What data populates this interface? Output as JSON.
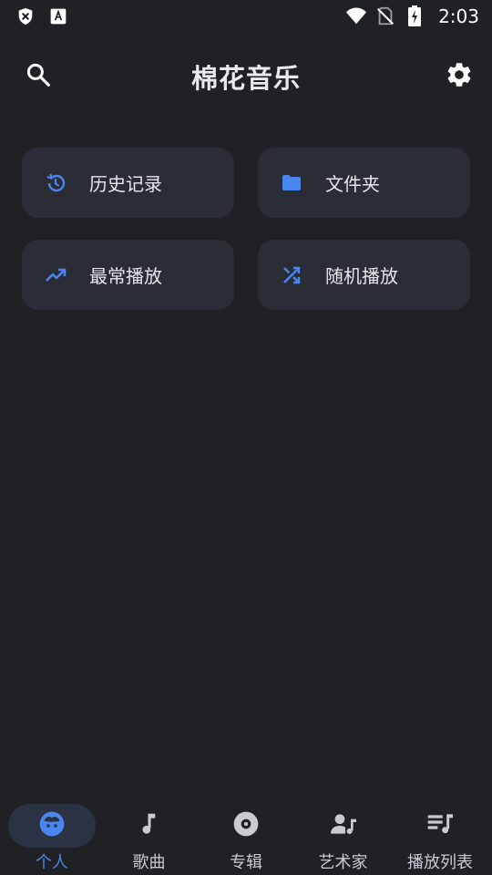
{
  "status_bar": {
    "time": "2:03",
    "left_icons": [
      "shield-x-icon",
      "text-a-icon"
    ],
    "right_icons": [
      "wifi-icon",
      "no-sim-icon",
      "battery-charging-icon"
    ]
  },
  "app_bar": {
    "title": "棉花音乐",
    "left_icon": "search-icon",
    "right_icon": "gear-icon"
  },
  "tiles": [
    {
      "label": "历史记录",
      "icon": "history-icon"
    },
    {
      "label": "文件夹",
      "icon": "folder-icon"
    },
    {
      "label": "最常播放",
      "icon": "trending-up-icon"
    },
    {
      "label": "随机播放",
      "icon": "shuffle-icon"
    }
  ],
  "bottom_nav": {
    "items": [
      {
        "label": "个人",
        "icon": "face-icon",
        "active": true
      },
      {
        "label": "歌曲",
        "icon": "music-note-icon",
        "active": false
      },
      {
        "label": "专辑",
        "icon": "album-icon",
        "active": false
      },
      {
        "label": "艺术家",
        "icon": "artist-icon",
        "active": false
      },
      {
        "label": "播放列表",
        "icon": "playlist-icon",
        "active": false
      }
    ]
  },
  "colors": {
    "background": "#202125",
    "tile": "#2a2d35",
    "accent": "#4a86f0",
    "active_pill": "#2a3244"
  }
}
